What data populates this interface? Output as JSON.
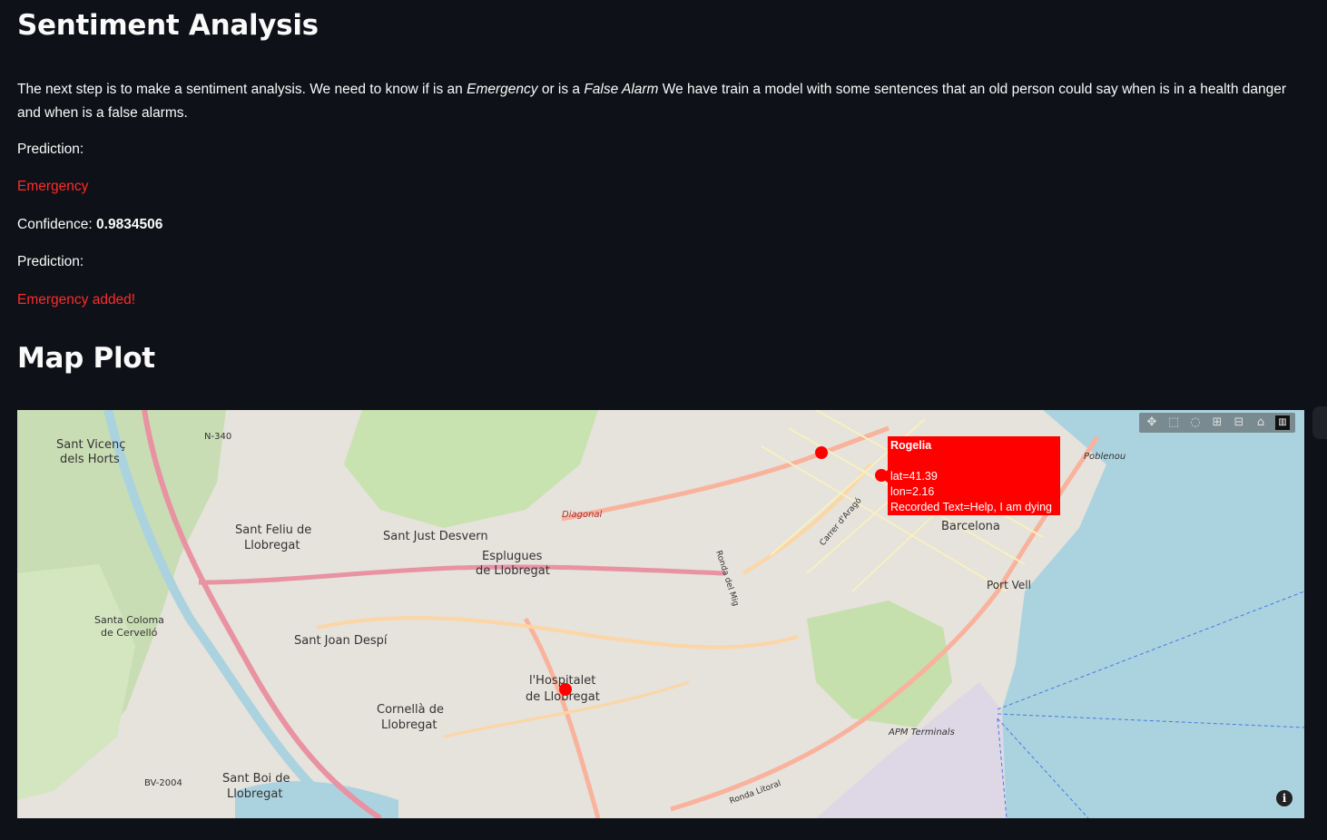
{
  "section1": {
    "title": "Sentiment Analysis",
    "intro_part1": "The next step is to make a sentiment analysis. We need to know if is an ",
    "intro_em1": "Emergency",
    "intro_part2": " or is a ",
    "intro_em2": "False Alarm",
    "intro_part3": " We have train a model with some sentences that an old person could say when is in a health danger and when is a false alarms.",
    "prediction_label_1": "Prediction:",
    "prediction_value": "Emergency",
    "confidence_label": "Confidence:",
    "confidence_value": "0.9834506",
    "prediction_label_2": "Prediction:",
    "added_message": "Emergency added!"
  },
  "section2": {
    "title": "Map Plot"
  },
  "map": {
    "tooltip": {
      "name": "Rogelia",
      "lat_text": "lat=41.39",
      "lon_text": "lon=2.16",
      "recorded_text": "Recorded Text=Help, I am dying"
    },
    "markers": [
      "Rogelia marker",
      "marker",
      "marker"
    ],
    "marker_color": "#ff0000",
    "place_labels": {
      "barcelona": "Barcelona",
      "port_vell": "Port Vell",
      "hospitalet1": "l'Hospitalet",
      "hospitalet2": "de Llobregat",
      "esplugues1": "Esplugues",
      "esplugues2": "de Llobregat",
      "sant_just": "Sant Just Desvern",
      "sant_feliu1": "Sant Feliu de",
      "sant_feliu2": "Llobregat",
      "sant_joan": "Sant Joan Despí",
      "cornella1": "Cornellà de",
      "cornella2": "Llobregat",
      "sant_boi1": "Sant Boi de",
      "sant_boi2": "Llobregat",
      "sant_vicenc1": "Sant Vicenç",
      "sant_vicenc2": "dels Horts",
      "santa_coloma1": "Santa Coloma",
      "santa_coloma2": "de Cervelló",
      "apm": "APM Terminals",
      "poblenou": "Poblenou",
      "n340": "N-340",
      "bv2004": "BV-2004",
      "ronda_litoral": "Ronda Litoral",
      "ronda_mig": "Ronda del Mig",
      "carrer_arago": "Carrer d'Aragó",
      "diagonal": "Diagonal"
    },
    "modebar_icons": [
      "pan-icon",
      "box-select-icon",
      "lasso-icon",
      "zoom-in-icon",
      "zoom-out-icon",
      "reset-home-icon",
      "plotly-logo-icon"
    ],
    "info_icon": "info-icon"
  },
  "colors": {
    "background": "#0e1117",
    "text": "#fafafa",
    "accent_red": "#ff2b2b",
    "water": "#aad3df",
    "park": "#c8e6b0",
    "urban": "#e0dfdf"
  }
}
